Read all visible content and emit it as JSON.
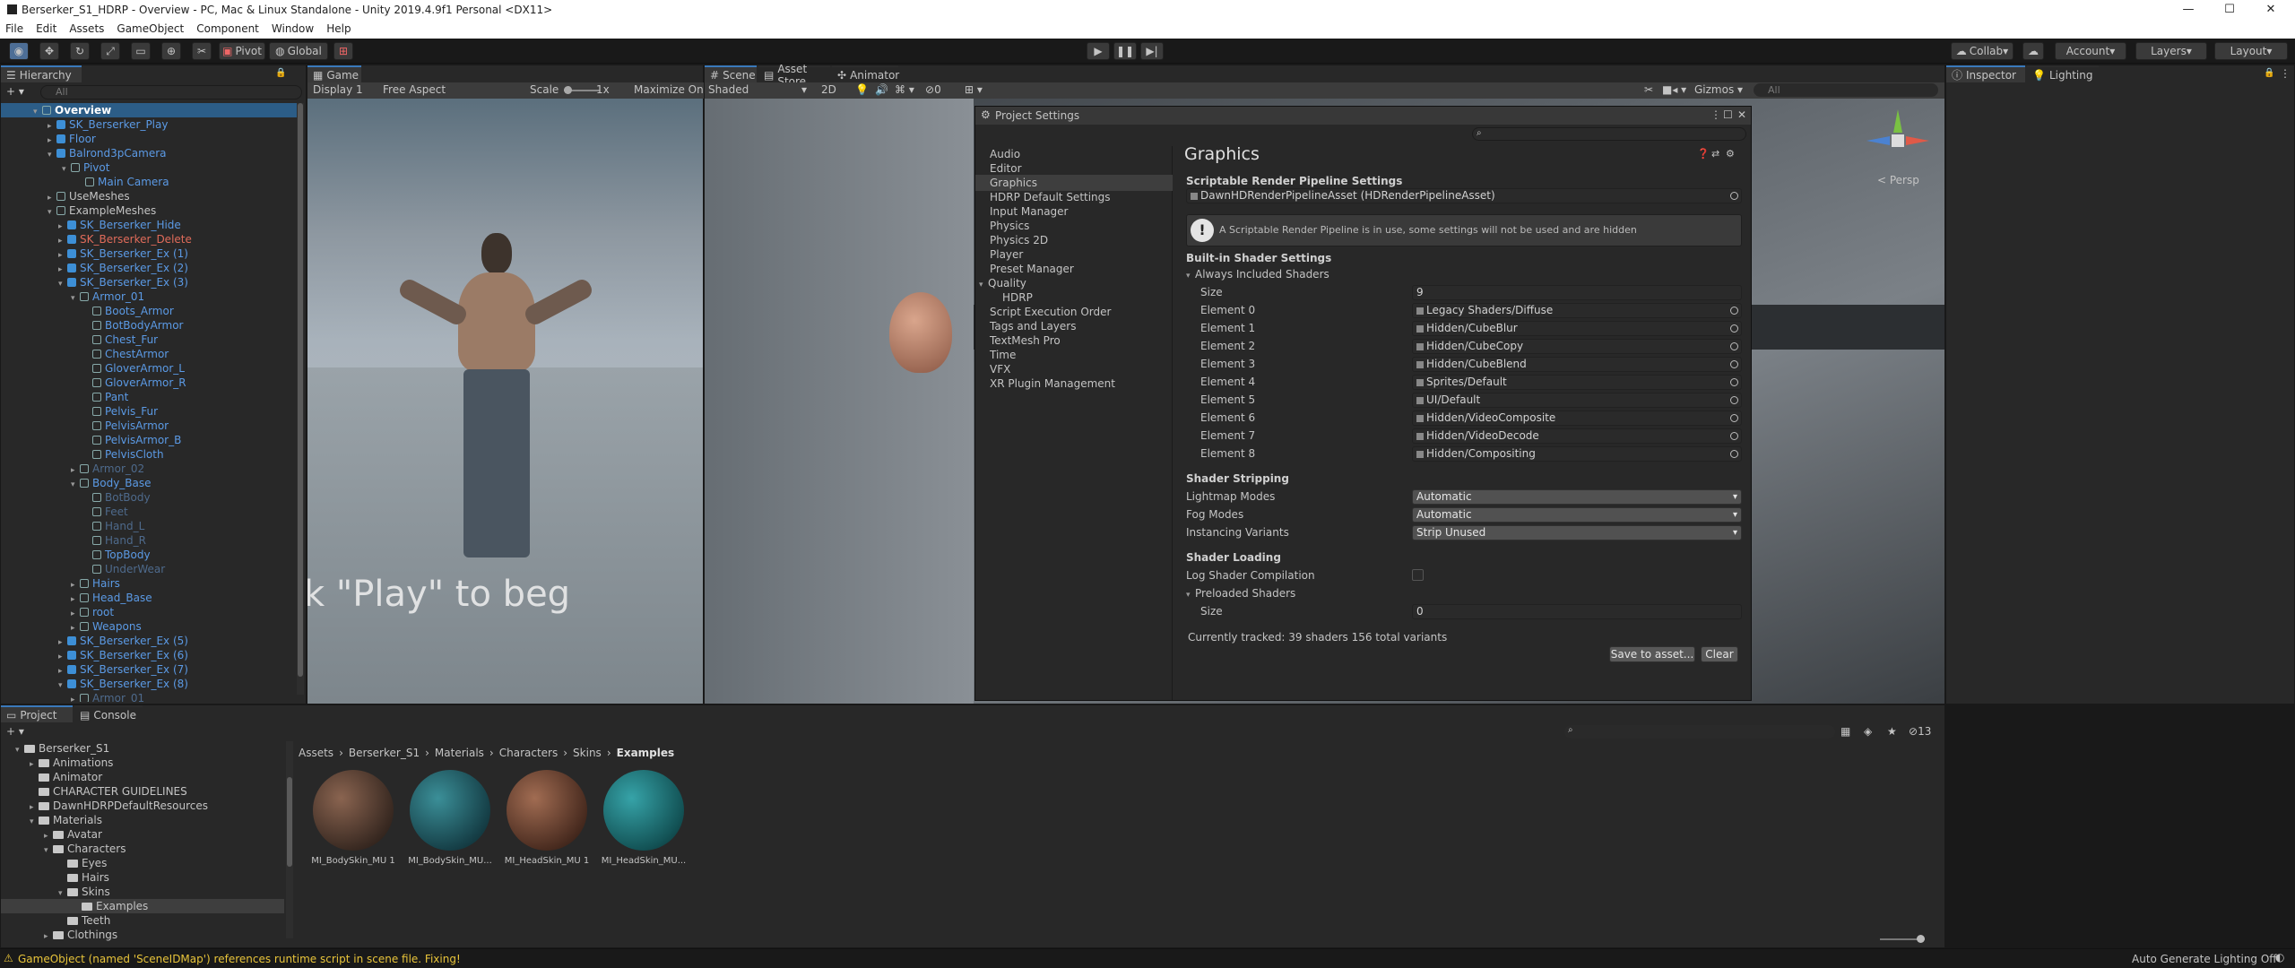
{
  "window": {
    "title": "Berserker_S1_HDRP - Overview - PC, Mac & Linux Standalone - Unity 2019.4.9f1 Personal <DX11>"
  },
  "menu": [
    "File",
    "Edit",
    "Assets",
    "GameObject",
    "Component",
    "Window",
    "Help"
  ],
  "toolbar": {
    "pivot": "Pivot",
    "global": "Global",
    "collab": "Collab",
    "account": "Account",
    "layers": "Layers",
    "layout": "Layout"
  },
  "hierarchy": {
    "tab": "Hierarchy",
    "search_placeholder": "All",
    "items": [
      {
        "label": "Overview"
      },
      {
        "label": "SK_Berserker_Play"
      },
      {
        "label": "Floor"
      },
      {
        "label": "Balrond3pCamera"
      },
      {
        "label": "Pivot"
      },
      {
        "label": "Main Camera"
      },
      {
        "label": "UseMeshes"
      },
      {
        "label": "ExampleMeshes"
      },
      {
        "label": "SK_Berserker_Hide"
      },
      {
        "label": "SK_Berserker_Delete"
      },
      {
        "label": "SK_Berserker_Ex (1)"
      },
      {
        "label": "SK_Berserker_Ex (2)"
      },
      {
        "label": "SK_Berserker_Ex (3)"
      },
      {
        "label": "Armor_01"
      },
      {
        "label": "Boots_Armor"
      },
      {
        "label": "BotBodyArmor"
      },
      {
        "label": "Chest_Fur"
      },
      {
        "label": "ChestArmor"
      },
      {
        "label": "GloverArmor_L"
      },
      {
        "label": "GloverArmor_R"
      },
      {
        "label": "Pant"
      },
      {
        "label": "Pelvis_Fur"
      },
      {
        "label": "PelvisArmor"
      },
      {
        "label": "PelvisArmor_B"
      },
      {
        "label": "PelvisCloth"
      },
      {
        "label": "Armor_02"
      },
      {
        "label": "Body_Base"
      },
      {
        "label": "BotBody"
      },
      {
        "label": "Feet"
      },
      {
        "label": "Hand_L"
      },
      {
        "label": "Hand_R"
      },
      {
        "label": "TopBody"
      },
      {
        "label": "UnderWear"
      },
      {
        "label": "Hairs"
      },
      {
        "label": "Head_Base"
      },
      {
        "label": "root"
      },
      {
        "label": "Weapons"
      },
      {
        "label": "SK_Berserker_Ex (5)"
      },
      {
        "label": "SK_Berserker_Ex (6)"
      },
      {
        "label": "SK_Berserker_Ex (7)"
      },
      {
        "label": "SK_Berserker_Ex (8)"
      },
      {
        "label": "Armor_01"
      }
    ]
  },
  "game": {
    "tab": "Game",
    "display": "Display 1",
    "aspect": "Free Aspect",
    "scale_label": "Scale",
    "scale_value": "1x",
    "maximize": "Maximize On",
    "overlay_text": "k \"Play\" to beg"
  },
  "scene": {
    "tabs": [
      "Scene",
      "Asset Store",
      "Animator"
    ],
    "shading": "Shaded",
    "mode2d": "2D",
    "gizmos": "Gizmos",
    "search_placeholder": "All",
    "persp": "< Persp",
    "fx_count": "0"
  },
  "project_settings": {
    "title": "Project Settings",
    "categories": [
      "Audio",
      "Editor",
      "Graphics",
      "HDRP Default Settings",
      "Input Manager",
      "Physics",
      "Physics 2D",
      "Player",
      "Preset Manager",
      "Quality",
      "HDRP",
      "Script Execution Order",
      "Tags and Layers",
      "TextMesh Pro",
      "Time",
      "VFX",
      "XR Plugin Management"
    ],
    "heading": "Graphics",
    "srp_section": "Scriptable Render Pipeline Settings",
    "srp_asset": "DawnHDRenderPipelineAsset (HDRenderPipelineAsset)",
    "warning": "A Scriptable Render Pipeline is in use, some settings will not be used and are hidden",
    "builtin_section": "Built-in Shader Settings",
    "always_included": "Always Included Shaders",
    "size_label": "Size",
    "size_value": "9",
    "elements": [
      {
        "label": "Element 0",
        "value": "Legacy Shaders/Diffuse"
      },
      {
        "label": "Element 1",
        "value": "Hidden/CubeBlur"
      },
      {
        "label": "Element 2",
        "value": "Hidden/CubeCopy"
      },
      {
        "label": "Element 3",
        "value": "Hidden/CubeBlend"
      },
      {
        "label": "Element 4",
        "value": "Sprites/Default"
      },
      {
        "label": "Element 5",
        "value": "UI/Default"
      },
      {
        "label": "Element 6",
        "value": "Hidden/VideoComposite"
      },
      {
        "label": "Element 7",
        "value": "Hidden/VideoDecode"
      },
      {
        "label": "Element 8",
        "value": "Hidden/Compositing"
      }
    ],
    "stripping_section": "Shader Stripping",
    "lightmap_label": "Lightmap Modes",
    "lightmap_value": "Automatic",
    "fog_label": "Fog Modes",
    "fog_value": "Automatic",
    "instancing_label": "Instancing Variants",
    "instancing_value": "Strip Unused",
    "loading_section": "Shader Loading",
    "log_label": "Log Shader Compilation",
    "preloaded": "Preloaded Shaders",
    "preloaded_size_label": "Size",
    "preloaded_size_value": "0",
    "tracked": "Currently tracked: 39 shaders 156 total variants",
    "save_button": "Save to asset...",
    "clear_button": "Clear"
  },
  "inspector": {
    "tab": "Inspector",
    "lighting_tab": "Lighting"
  },
  "project": {
    "tabs": [
      "Project",
      "Console"
    ],
    "tree": [
      "Berserker_S1",
      "Animations",
      "Animator",
      "CHARACTER GUIDELINES",
      "DawnHDRPDefaultResources",
      "Materials",
      "Avatar",
      "Characters",
      "Eyes",
      "Hairs",
      "Skins",
      "Examples",
      "Teeth",
      "Clothings"
    ],
    "breadcrumb": [
      "Assets",
      "Berserker_S1",
      "Materials",
      "Characters",
      "Skins",
      "Examples"
    ],
    "assets": [
      {
        "name": "MI_BodySkin_MU 1",
        "color": "#6b4a3c"
      },
      {
        "name": "MI_BodySkin_MU...",
        "color": "#1f5c66"
      },
      {
        "name": "MI_HeadSkin_MU 1",
        "color": "#7a4b35"
      },
      {
        "name": "MI_HeadSkin_MU...",
        "color": "#1c6a70"
      }
    ],
    "hidden_count": "13"
  },
  "status": {
    "message": "GameObject (named 'SceneIDMap') references runtime script in scene file. Fixing!",
    "right": "Auto Generate Lighting Off"
  }
}
